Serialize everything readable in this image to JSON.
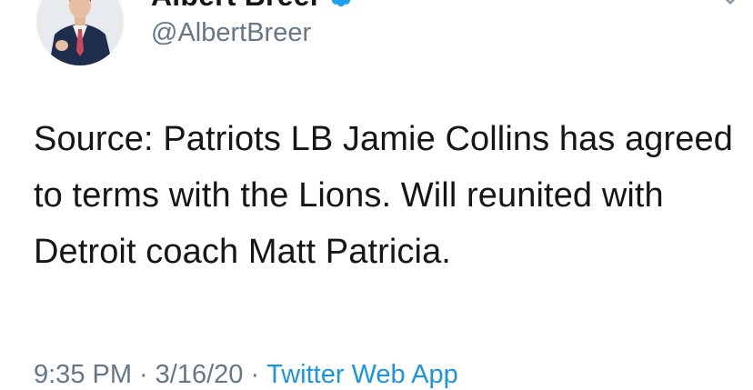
{
  "author": {
    "display_name": "Albert Breer",
    "handle": "@AlbertBreer",
    "verified_icon": "verified-badge-icon",
    "verified_color": "#1da1f2",
    "avatar": "profile-photo"
  },
  "tweet": {
    "text": "Source: Patriots LB Jamie Collins has agreed to terms with the Lions. Will reunited with Detroit coach Matt Patricia.",
    "time": "9:35 PM",
    "date": "3/16/20",
    "source": "Twitter Web App",
    "separator": "·"
  },
  "menu_icon": "chevron-down-icon",
  "colors": {
    "text": "#14171a",
    "secondary": "#657786",
    "link": "#1b95e0"
  }
}
